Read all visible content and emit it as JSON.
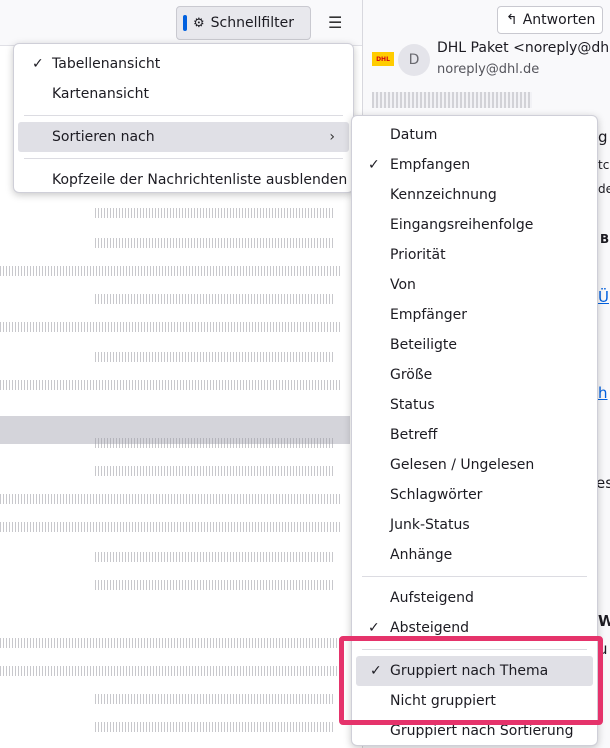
{
  "toolbar": {
    "quickfilter_label": "Schnellfilter"
  },
  "message": {
    "reply_label": "Antworten",
    "avatar_letter": "D",
    "logo_text": "DHL",
    "sender_name": "DHL Paket <noreply@dhl",
    "sender_email": "noreply@dhl.de",
    "fragments": [
      "g",
      "tc",
      "de",
      "B",
      "Ü",
      "h",
      "es",
      "W",
      "u"
    ]
  },
  "menu": {
    "items": [
      "Tabellenansicht",
      "Kartenansicht",
      "Sortieren nach",
      "Kopfzeile der Nachrichtenliste ausblenden"
    ]
  },
  "submenu": {
    "sort_fields": [
      "Datum",
      "Empfangen",
      "Kennzeichnung",
      "Eingangsreihenfolge",
      "Priorität",
      "Von",
      "Empfänger",
      "Beteiligte",
      "Größe",
      "Status",
      "Betreff",
      "Gelesen / Ungelesen",
      "Schlagwörter",
      "Junk-Status",
      "Anhänge"
    ],
    "order": [
      "Aufsteigend",
      "Absteigend"
    ],
    "grouping": [
      "Gruppiert nach Thema",
      "Nicht gruppiert",
      "Gruppiert nach Sortierung"
    ]
  },
  "checks": {
    "checked_symbol": "✓",
    "submenu_arrow": "›"
  },
  "colors": {
    "annotation": "#e5336b",
    "accent": "#0060df"
  }
}
